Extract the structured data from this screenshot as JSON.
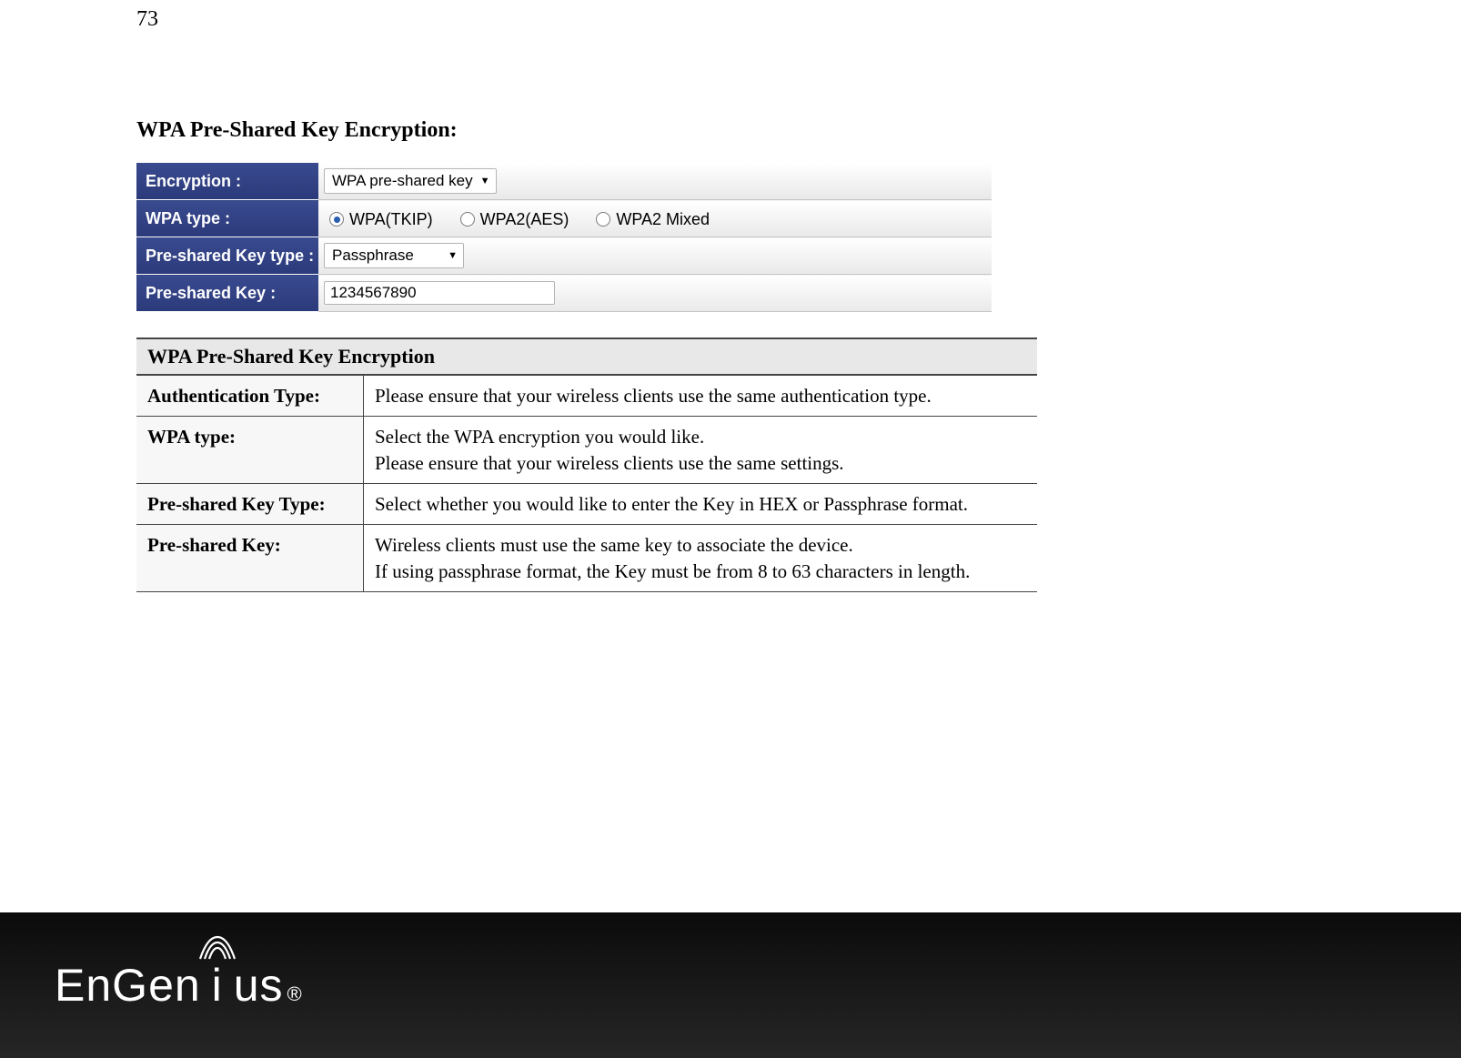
{
  "page_number": "73",
  "section_title": "WPA Pre-Shared Key Encryption:",
  "config": {
    "rows": [
      {
        "label": "Encryption :",
        "kind": "select",
        "value": "WPA pre-shared key"
      },
      {
        "label": "WPA type :",
        "kind": "radio",
        "options": [
          {
            "label": "WPA(TKIP)",
            "checked": true
          },
          {
            "label": "WPA2(AES)",
            "checked": false
          },
          {
            "label": "WPA2 Mixed",
            "checked": false
          }
        ]
      },
      {
        "label": "Pre-shared Key type :",
        "kind": "select2",
        "value": "Passphrase"
      },
      {
        "label": "Pre-shared Key :",
        "kind": "input",
        "value": "1234567890"
      }
    ]
  },
  "desc": {
    "header": "WPA Pre-Shared Key Encryption",
    "rows": [
      {
        "k": "Authentication Type:",
        "v": "Please ensure that your wireless clients use the same authentication type."
      },
      {
        "k": "WPA type:",
        "v": "Select the WPA encryption you would like.\nPlease ensure that your wireless clients use the same settings."
      },
      {
        "k": "Pre-shared Key Type:",
        "v": "Select whether you would like to enter the Key in HEX or Passphrase format."
      },
      {
        "k": "Pre-shared Key:",
        "v": "Wireless clients must use the same key to associate the device.\nIf using passphrase format, the Key must be from 8 to 63 characters in length."
      }
    ]
  },
  "footer": {
    "brand": "EnGenius",
    "reg": "®"
  }
}
